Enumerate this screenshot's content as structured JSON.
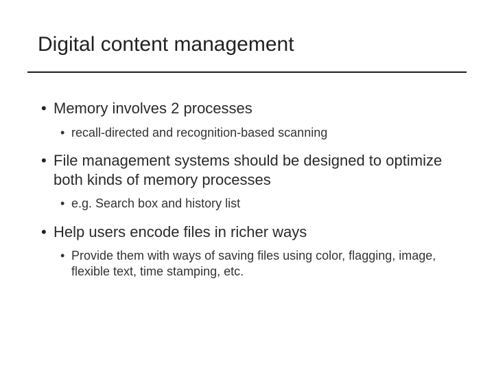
{
  "title": "Digital content management",
  "bullets": {
    "b1": "Memory involves 2 processes",
    "b1a": "recall-directed and recognition-based scanning",
    "b2": "File management systems should be designed to optimize both kinds of memory processes",
    "b2a": "e.g. Search box and history list",
    "b3": "Help users encode files in richer ways",
    "b3a": "Provide them with ways of saving files using color, flagging, image, flexible text, time stamping, etc."
  }
}
